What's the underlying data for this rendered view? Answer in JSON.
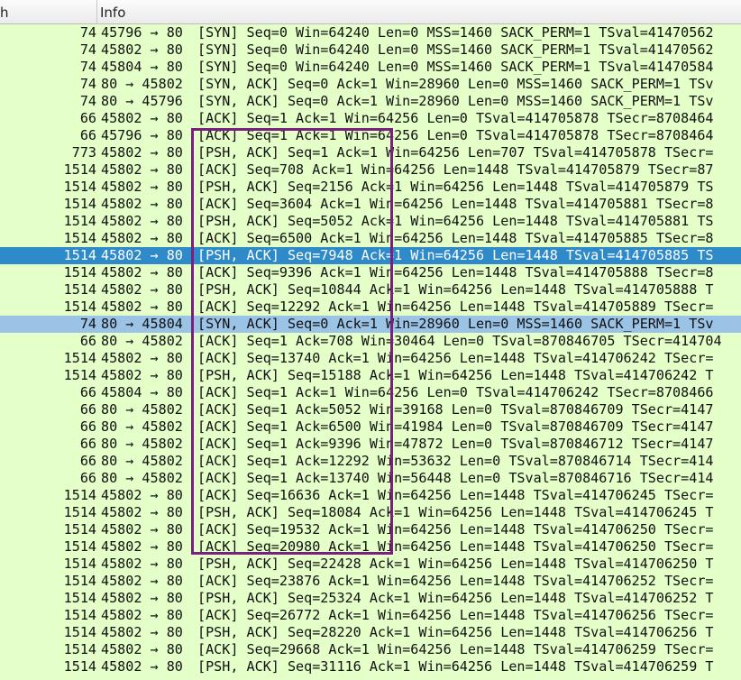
{
  "columns": {
    "length": "h",
    "info": "Info"
  },
  "rows": [
    {
      "len": "74",
      "ports": "45796 → 80",
      "info": "[SYN] Seq=0 Win=64240 Len=0 MSS=1460 SACK_PERM=1 TSval=41470562"
    },
    {
      "len": "74",
      "ports": "45802 → 80",
      "info": "[SYN] Seq=0 Win=64240 Len=0 MSS=1460 SACK_PERM=1 TSval=41470562"
    },
    {
      "len": "74",
      "ports": "45804 → 80",
      "info": "[SYN] Seq=0 Win=64240 Len=0 MSS=1460 SACK_PERM=1 TSval=41470584"
    },
    {
      "len": "74",
      "ports": "80 → 45802",
      "info": "[SYN, ACK] Seq=0 Ack=1 Win=28960 Len=0 MSS=1460 SACK_PERM=1 TSv"
    },
    {
      "len": "74",
      "ports": "80 → 45796",
      "info": "[SYN, ACK] Seq=0 Ack=1 Win=28960 Len=0 MSS=1460 SACK_PERM=1 TSv"
    },
    {
      "len": "66",
      "ports": "45802 → 80",
      "info": "[ACK] Seq=1 Ack=1 Win=64256 Len=0 TSval=414705878 TSecr=8708464"
    },
    {
      "len": "66",
      "ports": "45796 → 80",
      "info": "[ACK] Seq=1 Ack=1 Win=64256 Len=0 TSval=414705878 TSecr=8708464"
    },
    {
      "len": "773",
      "ports": "45802 → 80",
      "info": "[PSH, ACK] Seq=1 Ack=1 Win=64256 Len=707 TSval=414705878 TSecr="
    },
    {
      "len": "1514",
      "ports": "45802 → 80",
      "info": "[ACK] Seq=708 Ack=1 Win=64256 Len=1448 TSval=414705879 TSecr=87"
    },
    {
      "len": "1514",
      "ports": "45802 → 80",
      "info": "[PSH, ACK] Seq=2156 Ack=1 Win=64256 Len=1448 TSval=414705879 TS"
    },
    {
      "len": "1514",
      "ports": "45802 → 80",
      "info": "[ACK] Seq=3604 Ack=1 Win=64256 Len=1448 TSval=414705881 TSecr=8"
    },
    {
      "len": "1514",
      "ports": "45802 → 80",
      "info": "[PSH, ACK] Seq=5052 Ack=1 Win=64256 Len=1448 TSval=414705881 TS"
    },
    {
      "len": "1514",
      "ports": "45802 → 80",
      "info": "[ACK] Seq=6500 Ack=1 Win=64256 Len=1448 TSval=414705885 TSecr=8"
    },
    {
      "len": "1514",
      "ports": "45802 → 80",
      "info": "[PSH, ACK] Seq=7948 Ack=1 Win=64256 Len=1448 TSval=414705885 TS",
      "state": "selected"
    },
    {
      "len": "1514",
      "ports": "45802 → 80",
      "info": "[ACK] Seq=9396 Ack=1 Win=64256 Len=1448 TSval=414705888 TSecr=8"
    },
    {
      "len": "1514",
      "ports": "45802 → 80",
      "info": "[PSH, ACK] Seq=10844 Ack=1 Win=64256 Len=1448 TSval=414705888 T"
    },
    {
      "len": "1514",
      "ports": "45802 → 80",
      "info": "[ACK] Seq=12292 Ack=1 Win=64256 Len=1448 TSval=414705889 TSecr="
    },
    {
      "len": "74",
      "ports": "80 → 45804",
      "info": "[SYN, ACK] Seq=0 Ack=1 Win=28960 Len=0 MSS=1460 SACK_PERM=1 TSv",
      "state": "related"
    },
    {
      "len": "66",
      "ports": "80 → 45802",
      "info": "[ACK] Seq=1 Ack=708 Win=30464 Len=0 TSval=870846705 TSecr=414704"
    },
    {
      "len": "1514",
      "ports": "45802 → 80",
      "info": "[ACK] Seq=13740 Ack=1 Win=64256 Len=1448 TSval=414706242 TSecr="
    },
    {
      "len": "1514",
      "ports": "45802 → 80",
      "info": "[PSH, ACK] Seq=15188 Ack=1 Win=64256 Len=1448 TSval=414706242 T"
    },
    {
      "len": "66",
      "ports": "45804 → 80",
      "info": "[ACK] Seq=1 Ack=1 Win=64256 Len=0 TSval=414706242 TSecr=8708466"
    },
    {
      "len": "66",
      "ports": "80 → 45802",
      "info": "[ACK] Seq=1 Ack=5052 Win=39168 Len=0 TSval=870846709 TSecr=4147"
    },
    {
      "len": "66",
      "ports": "80 → 45802",
      "info": "[ACK] Seq=1 Ack=6500 Win=41984 Len=0 TSval=870846709 TSecr=4147"
    },
    {
      "len": "66",
      "ports": "80 → 45802",
      "info": "[ACK] Seq=1 Ack=9396 Win=47872 Len=0 TSval=870846712 TSecr=4147"
    },
    {
      "len": "66",
      "ports": "80 → 45802",
      "info": "[ACK] Seq=1 Ack=12292 Win=53632 Len=0 TSval=870846714 TSecr=414"
    },
    {
      "len": "66",
      "ports": "80 → 45802",
      "info": "[ACK] Seq=1 Ack=13740 Win=56448 Len=0 TSval=870846716 TSecr=414"
    },
    {
      "len": "1514",
      "ports": "45802 → 80",
      "info": "[ACK] Seq=16636 Ack=1 Win=64256 Len=1448 TSval=414706245 TSecr="
    },
    {
      "len": "1514",
      "ports": "45802 → 80",
      "info": "[PSH, ACK] Seq=18084 Ack=1 Win=64256 Len=1448 TSval=414706245 T"
    },
    {
      "len": "1514",
      "ports": "45802 → 80",
      "info": "[ACK] Seq=19532 Ack=1 Win=64256 Len=1448 TSval=414706250 TSecr="
    },
    {
      "len": "1514",
      "ports": "45802 → 80",
      "info": "[ACK] Seq=20980 Ack=1 Win=64256 Len=1448 TSval=414706250 TSecr="
    },
    {
      "len": "1514",
      "ports": "45802 → 80",
      "info": "[PSH, ACK] Seq=22428 Ack=1 Win=64256 Len=1448 TSval=414706250 T"
    },
    {
      "len": "1514",
      "ports": "45802 → 80",
      "info": "[ACK] Seq=23876 Ack=1 Win=64256 Len=1448 TSval=414706252 TSecr="
    },
    {
      "len": "1514",
      "ports": "45802 → 80",
      "info": "[PSH, ACK] Seq=25324 Ack=1 Win=64256 Len=1448 TSval=414706252 T"
    },
    {
      "len": "1514",
      "ports": "45802 → 80",
      "info": "[ACK] Seq=26772 Ack=1 Win=64256 Len=1448 TSval=414706256 TSecr="
    },
    {
      "len": "1514",
      "ports": "45802 → 80",
      "info": "[PSH, ACK] Seq=28220 Ack=1 Win=64256 Len=1448 TSval=414706256 T"
    },
    {
      "len": "1514",
      "ports": "45802 → 80",
      "info": "[ACK] Seq=29668 Ack=1 Win=64256 Len=1448 TSval=414706259 TSecr="
    },
    {
      "len": "1514",
      "ports": "45802 → 80",
      "info": "[PSH, ACK] Seq=31116 Ack=1 Win=64256 Len=1448 TSval=414706259 T"
    }
  ],
  "colors": {
    "row_background": "#e4ffc7",
    "selected_background": "#2f8ac9",
    "related_background": "#9bc3e6",
    "annotation_border": "#7a1f7d"
  }
}
